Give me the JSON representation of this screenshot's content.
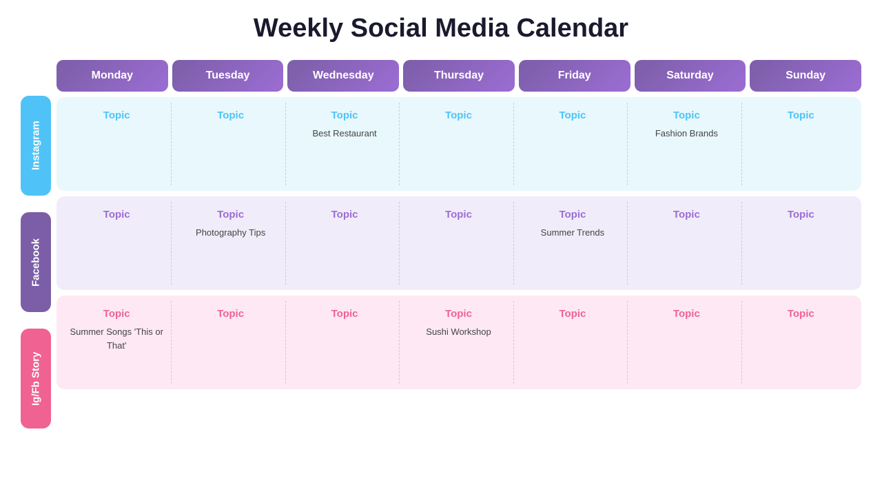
{
  "title": "Weekly Social Media Calendar",
  "days": [
    "Monday",
    "Tuesday",
    "Wednesday",
    "Thursday",
    "Friday",
    "Saturday",
    "Sunday"
  ],
  "rows": {
    "instagram": {
      "label": "Instagram",
      "cells": [
        {
          "topic": "Topic",
          "content": ""
        },
        {
          "topic": "Topic",
          "content": ""
        },
        {
          "topic": "Topic",
          "content": "Best Restaurant"
        },
        {
          "topic": "Topic",
          "content": ""
        },
        {
          "topic": "Topic",
          "content": ""
        },
        {
          "topic": "Topic",
          "content": "Fashion Brands"
        },
        {
          "topic": "Topic",
          "content": ""
        }
      ]
    },
    "facebook": {
      "label": "Facebook",
      "cells": [
        {
          "topic": "Topic",
          "content": ""
        },
        {
          "topic": "Topic",
          "content": "Photography Tips"
        },
        {
          "topic": "Topic",
          "content": ""
        },
        {
          "topic": "Topic",
          "content": ""
        },
        {
          "topic": "Topic",
          "content": "Summer Trends"
        },
        {
          "topic": "Topic",
          "content": ""
        },
        {
          "topic": "Topic",
          "content": ""
        }
      ]
    },
    "igfbstory": {
      "label": "Ig/Fb Story",
      "cells": [
        {
          "topic": "Topic",
          "content": "Summer Songs\n'This or That'"
        },
        {
          "topic": "Topic",
          "content": ""
        },
        {
          "topic": "Topic",
          "content": ""
        },
        {
          "topic": "Topic",
          "content": "Sushi Workshop"
        },
        {
          "topic": "Topic",
          "content": ""
        },
        {
          "topic": "Topic",
          "content": ""
        },
        {
          "topic": "Topic",
          "content": ""
        }
      ]
    }
  }
}
